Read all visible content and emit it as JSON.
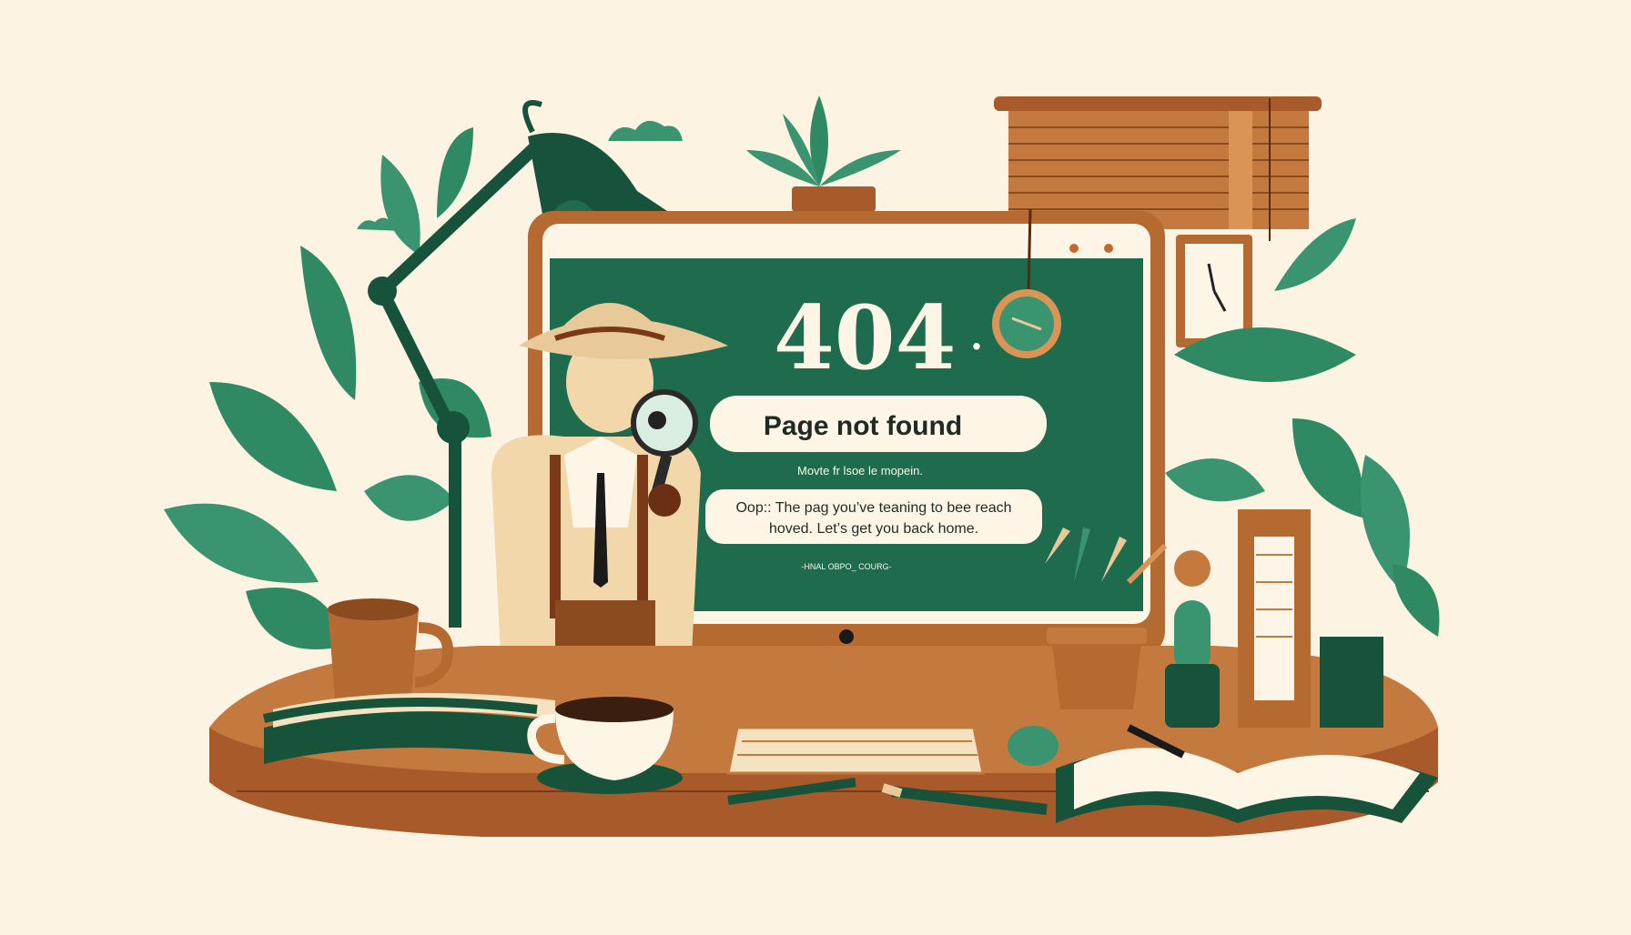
{
  "error_page": {
    "code": "404",
    "code_suffix": "·",
    "title": "Page not found",
    "subtitle": "Movte fr lsoe le mopein.",
    "message_line1": "Oop:: The pag you’ve teaning to bee reach",
    "message_line2": "hoved. Let’s get you back home.",
    "footer_text": "-HNAL OBPO_ COURG-"
  },
  "colors": {
    "background": "#fcf3e3",
    "screen_green": "#1f6b4e",
    "leaf_green": "#2f8a63",
    "dark_green": "#17523b",
    "wood": "#a85a2a",
    "wood_dark": "#7a3a18",
    "cream": "#f5e2c0",
    "tan": "#e8c99a"
  },
  "icons": {
    "monitor": "monitor-icon",
    "lamp": "desk-lamp-icon",
    "magnifier": "magnifying-glass-icon",
    "clock": "wall-clock-icon",
    "coffee": "coffee-cup-icon"
  }
}
